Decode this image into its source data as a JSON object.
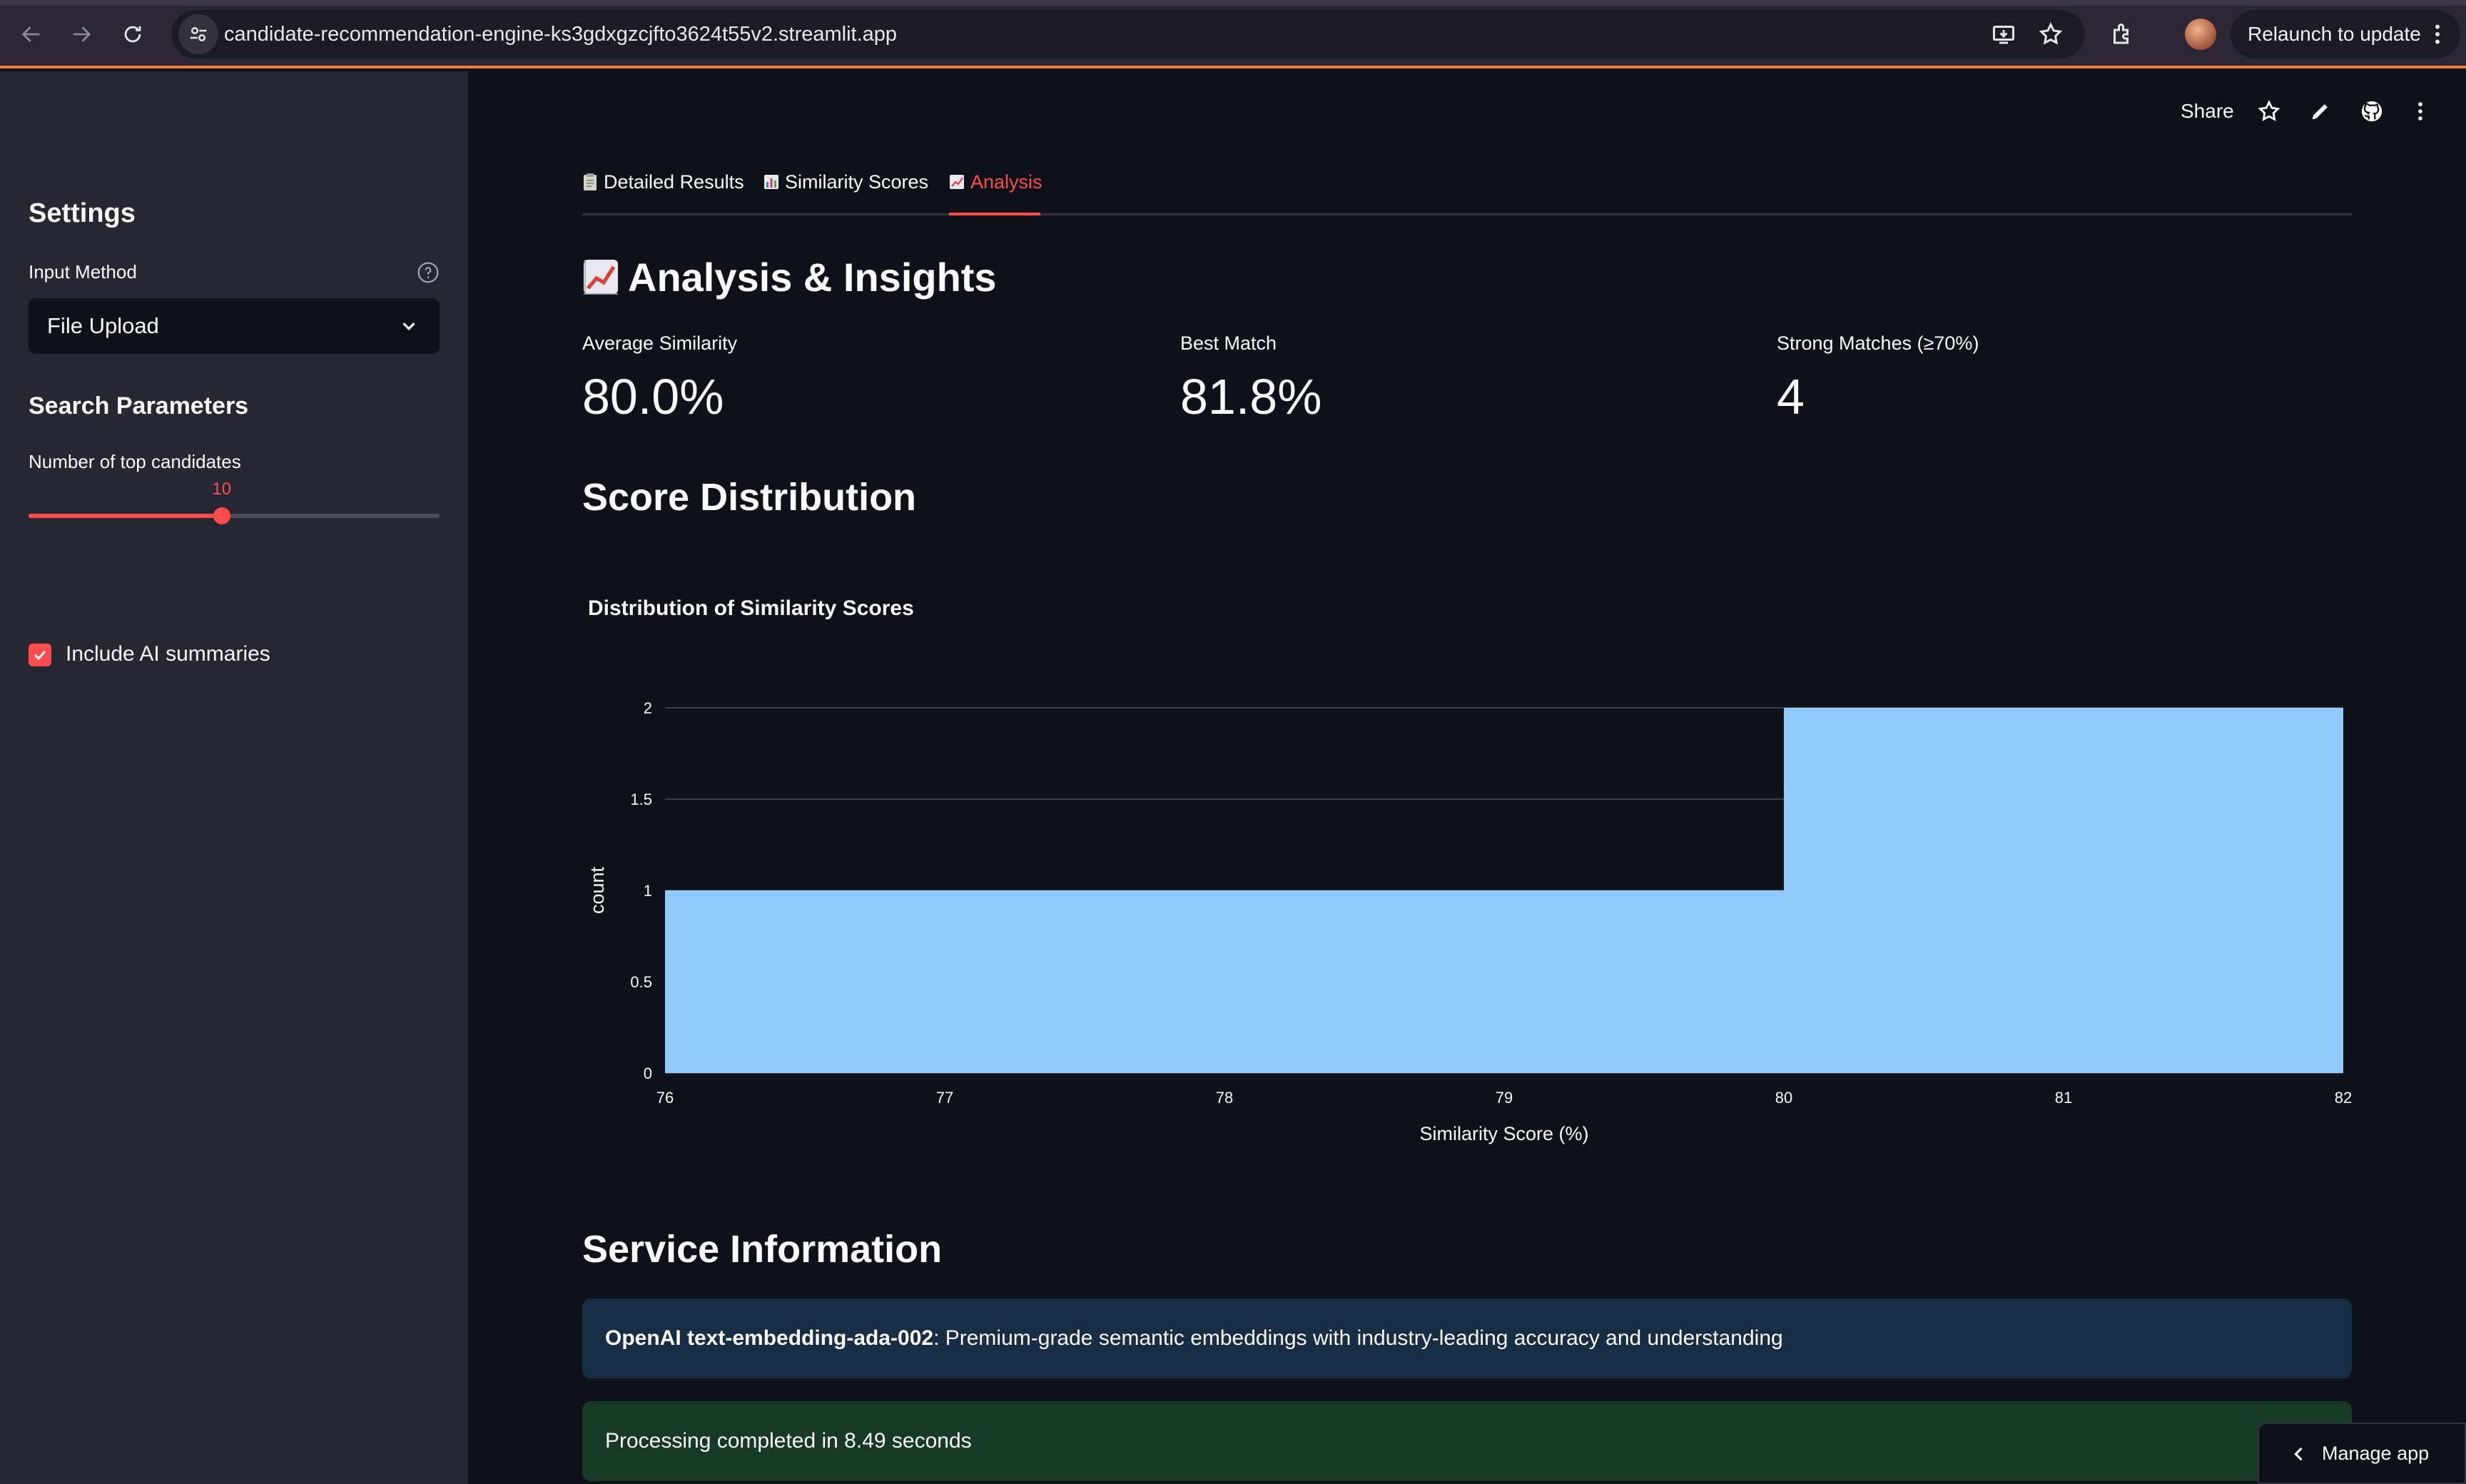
{
  "browser": {
    "url": "candidate-recommendation-engine-ks3gdxgzcjfto3624t55v2.streamlit.app",
    "relaunch_label": "Relaunch to update"
  },
  "sidebar": {
    "settings_title": "Settings",
    "input_method_label": "Input Method",
    "input_method_value": "File Upload",
    "search_params_title": "Search Parameters",
    "top_candidates_label": "Number of top candidates",
    "top_candidates_value": "10",
    "top_candidates_fraction": 0.47,
    "ai_summaries_label": "Include AI summaries",
    "ai_summaries_checked": true
  },
  "header": {
    "share_label": "Share"
  },
  "tabs": [
    {
      "label": "Detailed Results",
      "icon": "clipboard-icon",
      "active": false
    },
    {
      "label": "Similarity Scores",
      "icon": "bar-chart-icon",
      "active": false
    },
    {
      "label": "Analysis",
      "icon": "trend-chart-icon",
      "active": true
    }
  ],
  "analysis": {
    "title": "Analysis & Insights",
    "metrics": [
      {
        "label": "Average Similarity",
        "value": "80.0%"
      },
      {
        "label": "Best Match",
        "value": "81.8%"
      },
      {
        "label": "Strong Matches (≥70%)",
        "value": "4"
      }
    ],
    "score_distribution_title": "Score Distribution",
    "service_title": "Service Information",
    "service_model": "OpenAI text-embedding-ada-002",
    "service_desc": ": Premium-grade semantic embeddings with industry-leading accuracy and understanding",
    "processing_text": "Processing completed in 8.49 seconds"
  },
  "chart_data": {
    "type": "bar",
    "title": "Distribution of Similarity Scores",
    "xlabel": "Similarity Score (%)",
    "ylabel": "count",
    "bins": [
      [
        76,
        80
      ],
      [
        80,
        82
      ]
    ],
    "values": [
      1,
      2
    ],
    "xlim": [
      76,
      82
    ],
    "ylim": [
      0,
      2
    ],
    "xticks": [
      "76",
      "77",
      "78",
      "79",
      "80",
      "81",
      "82"
    ],
    "yticks": [
      "0",
      "0.5",
      "1",
      "1.5",
      "2"
    ],
    "bar_color": "#90c8f8",
    "grid": true
  },
  "footer": {
    "manage_app_label": "Manage app"
  },
  "colors": {
    "accent": "#ff4b4b",
    "background": "#0e1117",
    "sidebar": "#262730",
    "info_bg": "#172d43",
    "success_bg": "#173928"
  }
}
